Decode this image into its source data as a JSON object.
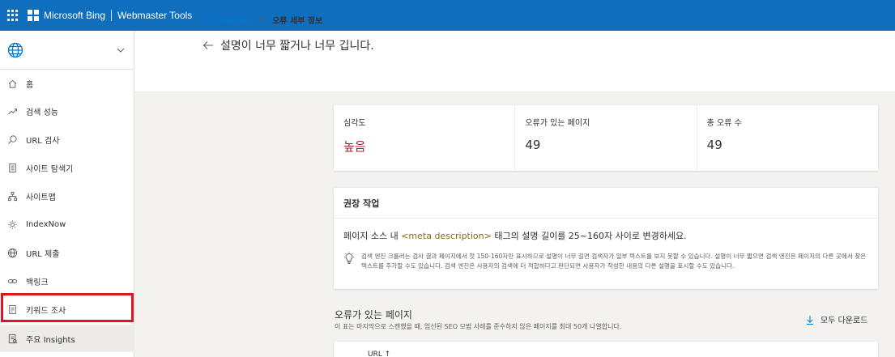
{
  "topbar": {
    "brand": "Microsoft Bing",
    "product": "Webmaster Tools"
  },
  "sidebar": {
    "items": [
      {
        "label": "홈",
        "icon": "home-icon"
      },
      {
        "label": "검색 성능",
        "icon": "trend-icon"
      },
      {
        "label": "URL 검사",
        "icon": "search-icon"
      },
      {
        "label": "사이트 탐색기",
        "icon": "document-icon"
      },
      {
        "label": "사이트맵",
        "icon": "sitemap-icon"
      },
      {
        "label": "IndexNow",
        "icon": "gear-icon"
      },
      {
        "label": "URL 제출",
        "icon": "globe-icon"
      },
      {
        "label": "백링크",
        "icon": "link-icon"
      },
      {
        "label": "키워드 조사",
        "icon": "report-icon"
      },
      {
        "label": "주요 Insights",
        "icon": "insights-icon"
      }
    ]
  },
  "breadcrumb": {
    "parent": "주요 Insights",
    "current": "오류 세부 정보"
  },
  "page_title": "설명이 너무 짧거나 너무 깁니다.",
  "metrics": [
    {
      "label": "심각도",
      "value": "높음"
    },
    {
      "label": "오류가 있는 페이지",
      "value": "49"
    },
    {
      "label": "총 오류 수",
      "value": "49"
    }
  ],
  "recommendation": {
    "title": "권장 작업",
    "main_before": "페이지 소스 내 ",
    "main_meta": "<meta description>",
    "main_after": " 태그의 설명 길이를 25~160자 사이로 변경하세요.",
    "note": "검색 엔진 크롤러는 검사 결과 페이지에서 첫 150-160자만 표시하므로 설명이 너무 길면 검색자가 일부 텍스트를 보지 못할 수 있습니다. 설명이 너무 짧으면 검색 엔진은 페이지의 다른 곳에서 찾은 텍스트를 추가할 수도 있습니다. 검색 엔진은 사용자의 검색에 더 적합하다고 판단되면 사용자가 작성한 내용의 다른 설명을 표시할 수도 있습니다."
  },
  "pages_section": {
    "title": "오류가 있는 페이지",
    "subtitle": "이 표는 마지막으로 스캔했을 때, 엄선된 SEO 모범 사례를 준수하지 않은 페이지를 최대 50개 나열합니다.",
    "download": "모두 다운로드",
    "column_url": "URL ↑"
  }
}
